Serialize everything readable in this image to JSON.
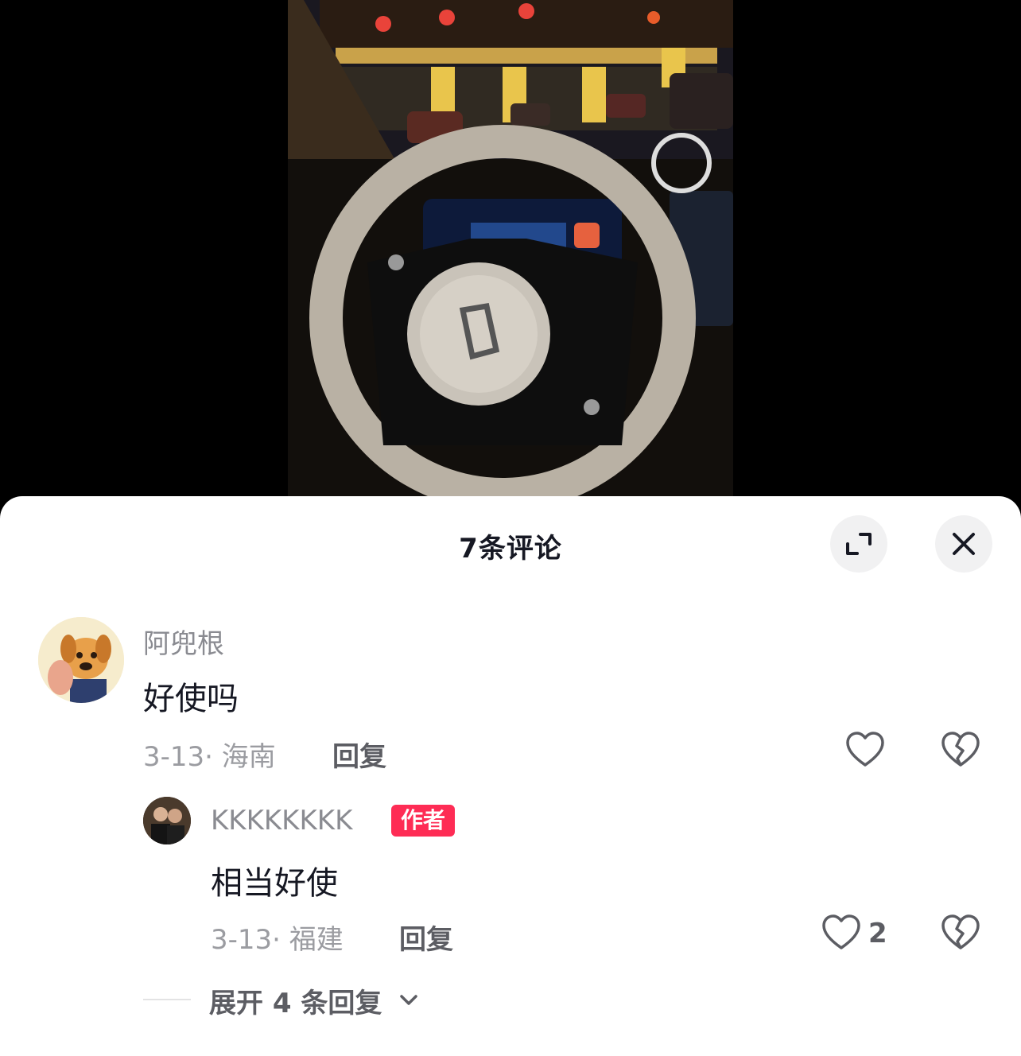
{
  "comments_header": {
    "title": "7条评论"
  },
  "comments": [
    {
      "username": "阿兜根",
      "text": "好使吗",
      "date_location": "3-13· 海南",
      "reply_label": "回复"
    },
    {
      "username": "KKKKKKKK",
      "badge": "作者",
      "text": "相当好使",
      "date_location": "3-13· 福建",
      "reply_label": "回复",
      "like_count": "2"
    }
  ],
  "expand_replies": {
    "label": "展开 4 条回复"
  },
  "icons": {
    "expand": "expand-icon",
    "close": "close-icon",
    "like": "heart-icon",
    "dislike": "broken-heart-icon",
    "chevron": "chevron-down-icon"
  },
  "colors": {
    "badge": "#fe2c55",
    "text_primary": "#161823",
    "text_secondary": "#8a8b91"
  }
}
